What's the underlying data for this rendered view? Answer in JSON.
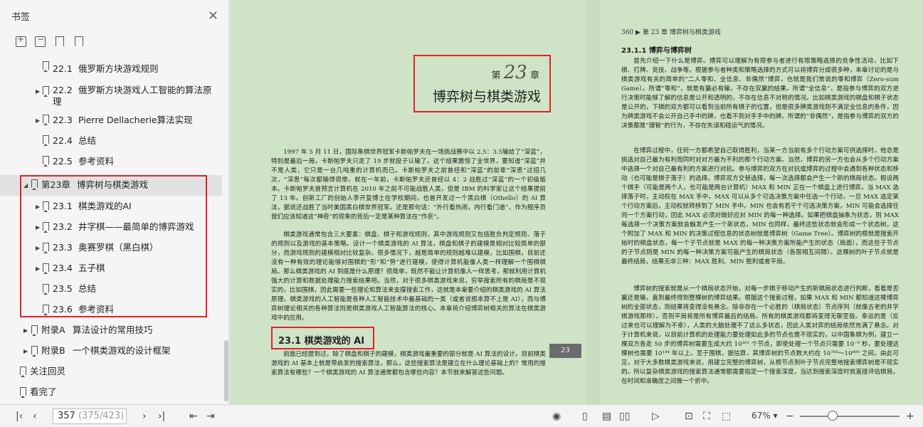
{
  "sidebar": {
    "title": "书签",
    "toc": [
      {
        "num": "22.1",
        "label": "俄罗斯方块游戏规则",
        "expand": false
      },
      {
        "num": "22.2",
        "label": "俄罗斯方块游戏人工智能的算法原",
        "label2": "理",
        "expand": true
      },
      {
        "num": "22.3",
        "label": "Pierre Dellacherie算法实现",
        "expand": true
      },
      {
        "num": "22.4",
        "label": "总结",
        "expand": false
      },
      {
        "num": "22.5",
        "label": "参考资料",
        "expand": false
      },
      {
        "num": "第23章",
        "label": "博弈树与棋类游戏",
        "expand": "open"
      },
      {
        "num": "23.1",
        "label": "棋类游戏的AI",
        "expand": true
      },
      {
        "num": "23.2",
        "label": "井字棋——最简单的博弈游戏",
        "expand": true
      },
      {
        "num": "23.3",
        "label": "奥赛罗棋（黑白棋）",
        "expand": true
      },
      {
        "num": "23.4",
        "label": "五子棋",
        "expand": true
      },
      {
        "num": "23.5",
        "label": "总结",
        "expand": false
      },
      {
        "num": "23.6",
        "label": "参考资料",
        "expand": false
      },
      {
        "num": "附录A",
        "label": "算法设计的常用技巧",
        "expand": true
      },
      {
        "num": "附录B",
        "label": "一个棋类游戏的设计框架",
        "expand": true
      },
      {
        "num": "",
        "label": "关注回灵",
        "expand": false
      },
      {
        "num": "",
        "label": "看完了",
        "expand": false
      }
    ]
  },
  "document": {
    "chapter_prefix": "第",
    "chapter_number": "23",
    "chapter_suffix": "章",
    "chapter_title": "博弈树与棋类游戏",
    "intro_para1": "1997 年 5 月 11 日，国际象棋世界冠军卡斯帕罗夫在一场挑战赛中以 2.5：3.5输给了“深蓝”，特别是最后一局，卡斯帕罗夫只走了 19 步就投子认输了。这个结果震惊了全世界，要知道“深蓝”并不是人类，它只是一台几吨重的计算机而已。卡斯帕罗夫之前曾经和“深蓝”的前辈“深思”过招几次，“深思”每次都输得很惨。就在一年前，卡斯帕罗夫还曾经以 4：2 战胜过“深蓝”的一个初级版本。卡斯帕罗夫曾预言计算机在 2010 年之前不可能战胜人类，但是 IBM 的科学家让这个结果提前了 13 年。创新工厂的创始人李开复博士在学校期间，也曾开发过一个黑白棋（Othello）的 AI 算法，据说还战胜了当时美国黑白棋世界冠军。还是那句话：“外行看热闹，内行看门道”，作为程序员我们应该知道这“神奇”的现象的背后一定是某种算法在“作祟”。",
    "intro_para2": "棋类游戏通常包含三大要素：棋盘、棋子和游戏规则，其中游戏规则又包括胜负判定规则、落子的规则以及游戏的基本策略。设计一个棋类游戏的 AI 算法，棋盘和棋子的建模是相对比较简单的部分，而游戏规则的建模相对比较复杂。很多情况下，越是简单的规则越难以建模，比如围棋，目前还没有一种有效的理论能够对围棋的“形”和“势”进行建模，使得计算机能像人类一样理解一个围棋棋局。那么棋类游戏的 AI 到底是什么原理？很简单，既然不能让计算机像人一样思考，那就利用计算机强大的计算和数据处理能力搜索结果吧。当然，对于很多棋类游戏来说，穷举搜索所有的棋局是不现实的，比如围棋，因此需要一些理论和算法来支撑搜索工作，这就是本章要介绍的棋类游戏的 AI 算法原理。棋类游戏的人工智能是各种人工智能技术中最基础的一类（或者说根本算不上是 AI），而与博弈树理论相关的各种算法则是棋类游戏人工智能算法的核心。本章将介绍博弈树相关的算法在棋类游戏中的应用。",
    "section_title": "23.1   棋类游戏的 AI",
    "section_para": "前面已经提到过，除了棋盘和棋子的建模，棋类游戏最重要的部分就是 AI 算法的设计。目前棋类游戏的 AI 基本上就是带启发的搜索算法，那么，这些搜索算法是建立在什么理论基础上的？常用的搜索算法有哪些？一个棋类游戏的 AI 算法通常都包含哪些内容？本节就来解答这些问题。",
    "left_page_tab": "23",
    "right_header": "360  ▶ 第 23 章   博弈树与棋类游戏",
    "right_section": "23.1.1   博弈与博弈树",
    "right_para1": "首先介绍一下什么是博弈。博弈可以理解为有限参与者进行有限策略选择的竞争性活动，比如下棋、打牌、竞技、战争等。根据参与者种类和策略选择的方式可以将博弈分成很多种，本章讨论的是与棋类游戏有关的简单的“二人零和、全信息、非偶然”博弈，也就是我们常说的零和博弈（Zero-sum Game）。所谓“零和”，就是有赢必有输，不存在双赢的结果。所谓“全信息”，是指参与博弈的双方进行决策时能够了解的信息是公开和透明的，不存在信息不对称的情况。比如棋类游戏的棋盘和棋子状态是公开的，下棋的双方都可以看到当前所有棋子的位置，但是很多牌类游戏则不满足全信息的条件，因为牌类游戏不会公开自己手中的牌，也看不到对手手中的牌。所谓的“非偶然”，是指参与博弈的双方的决策都是“理智”的行为，不存在失误和碰运气的情况。",
    "right_para2": "在博弈过程中，任何一方都希望自己取得胜利，当某一方当前有多个行动方案可供选择时，他总是挑选对自己最为有利而同时对对方最为不利的那个行动方案。当然，博弈的另一方也会从多个行动方案中选择一个对自己最有利的方案进行对抗。参与博弈的双方在对抗或博弈的过程中会遇到各种状态和移动（也可能是棋子落子）的选择，博弈双方交替选择，每一次选择都会产生一个新的棋局状态。假设两个棋手（可能是两个人，也可能是两台计算机）MAX 和 MIN 正在一个棋盘上进行博弈。当 MAX 选择落子时，主动权在 MAX 手中，MAX 可以从多个可选决策方案中任选一个行动，一旦 MAX 选定某个行动方案后，主动权就转移到了 MIN 手中。MIN 也会有若干个可选决策方案，MIN 可能会选择任何一个方案行动，因此 MAX 必须对做好应对 MIN 的每一种选择。如果把棋盘抽象为状态，则 MAX 每选择一个决策方案就会触发产生一个新状态，MIN 也同样，最终这些状态就会形成一个状态树，这个附加了 MAX 和 MIN 的决策过程信息的状态树就是博弈树（Game Tree）。博弈树的根就是搜索开始时的棋盘状态，每一个子节点就是 MAX 的每一种决策方案所能产生的状态（局面），而这些子节点的子节点则是 MIN 的每一种决策方案可能产生的棋局状态（各层相互间隔）。这棵树的叶子节点就是最终结局，结果无非三种：MAX 胜利、MIN 胜利或者平局。",
    "right_para3": "博弈树的搜索就是从一个棋局状态开始，对每一步棋子移动产生的新棋局状态进行判断，看看是否赢还是输，直到最终得到整棵树的博弈结果。根据这个搜索过程，如果 MAX 和 MIN 都知道这棵博弈树的全部状态，则结果将变得没有悬念。除非存在一个必胜的（棋局状态）节点序列（就像古老的井字棋游戏那样），否则平局将是所有博弈最后的结局。所有的棋类游戏都将变得无聊至极。幸运的是（反过来也可以理解为不幸），人类的大脑处理不了这么多状态，因此人类对弈的结局依然充满了悬念。对于计算机来说，以目前计算机的处理能力要处理如此多的节点也是不现实的，以中国象棋为例，建立一棵双方各走 50 步的博弈树需要生成大约 10¹⁶¹ 个节点，即使处理一个节点只需要 10⁻⁹ 秒，要处理这棵树也需要 10¹⁴⁴ 年以上。至于围棋，据估算，其博弈树的节点数大约在 10⁷⁶⁸～10⁸⁰⁰ 之间，由此可见，对于大多数棋类游戏来说，用建立完整的博弈树，从根节点到叶子节点完整地搜索博弈树是不现实的。所以复杂棋类游戏的搜索算法通常都需要指定一个搜索深度，当达到搜索深度时就直接评估棋局，在时间和准确度之间做一个折中。"
  },
  "toolbar": {
    "page_current": "357",
    "page_total": " (375/423)",
    "zoom": "67%"
  }
}
